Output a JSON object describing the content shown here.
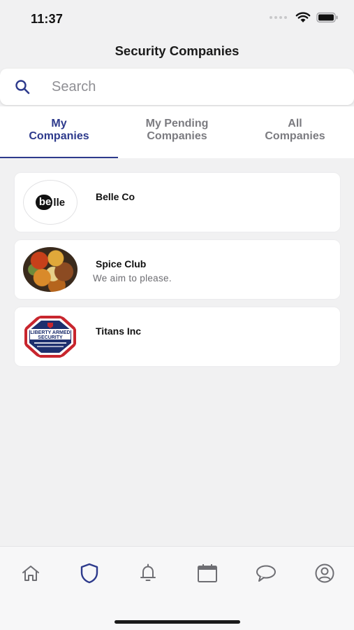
{
  "status": {
    "time": "11:37"
  },
  "header": {
    "title": "Security Companies"
  },
  "search": {
    "placeholder": "Search",
    "value": ""
  },
  "tabs": [
    {
      "label": "My\nCompanies",
      "active": true
    },
    {
      "label": "My Pending\nCompanies",
      "active": false
    },
    {
      "label": "All\nCompanies",
      "active": false
    }
  ],
  "companies": [
    {
      "name": "Belle Co",
      "tagline": "",
      "logo": "belle-logo",
      "logo_text_a": "be",
      "logo_text_b": "lle"
    },
    {
      "name": "Spice Club",
      "tagline": "We aim to please.",
      "logo": "spice-photo"
    },
    {
      "name": "Titans Inc",
      "tagline": "",
      "logo": "liberty-armed-security-logo",
      "logo_text": "LIBERTY ARMED SECURITY"
    }
  ],
  "tabbar": [
    {
      "icon": "home-icon",
      "active": false
    },
    {
      "icon": "shield-icon",
      "active": true
    },
    {
      "icon": "bell-icon",
      "active": false
    },
    {
      "icon": "calendar-icon",
      "active": false
    },
    {
      "icon": "chat-bubble-icon",
      "active": false
    },
    {
      "icon": "profile-icon",
      "active": false
    }
  ],
  "colors": {
    "accent": "#2d3a8c",
    "inactive": "#7b7b80",
    "background": "#f1f1f2"
  }
}
